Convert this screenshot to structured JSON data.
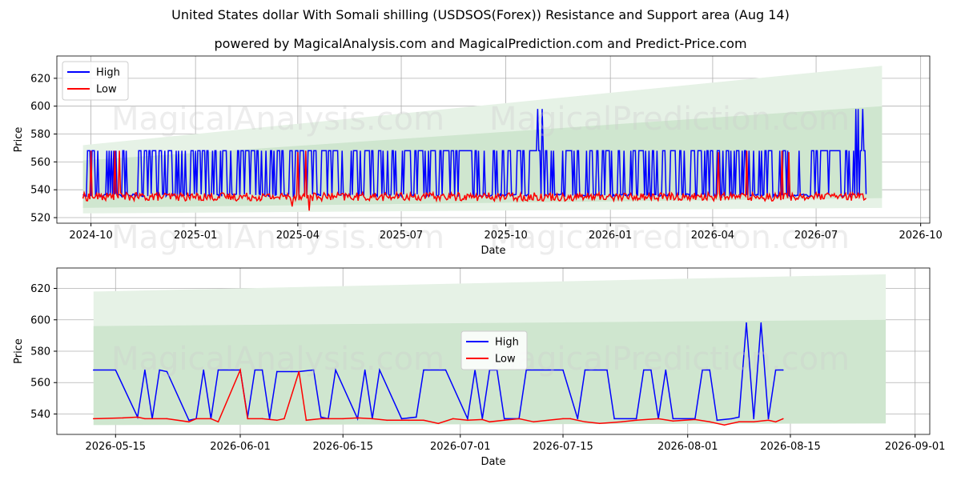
{
  "header": {
    "title": "United States dollar With Somali shilling (USDSOS(Forex)) Resistance and Support area (Aug 14)",
    "subtitle": "powered by MagicalAnalysis.com and MagicalPrediction.com and Predict-Price.com"
  },
  "watermarks": [
    "MagicalAnalysis.com",
    "MagicalPrediction.com"
  ],
  "colors": {
    "high": "#0000ff",
    "low": "#ff0000",
    "band_light": "#e6f2e6",
    "band_dark": "#cfe6cf",
    "grid": "#b0b0b0"
  },
  "chart_data": [
    {
      "type": "line",
      "xlabel": "Date",
      "ylabel": "Price",
      "x_range": [
        "2024-09-01",
        "2026-10-09"
      ],
      "ylim": [
        516,
        636
      ],
      "x_ticks": [
        "2024-10",
        "2025-01",
        "2025-04",
        "2025-07",
        "2025-10",
        "2026-01",
        "2026-04",
        "2026-07",
        "2026-10"
      ],
      "y_ticks": [
        520,
        540,
        560,
        580,
        600,
        620
      ],
      "grid": true,
      "legend": "top-left",
      "legend_entries": [
        "High",
        "Low"
      ],
      "bands": [
        {
          "x": [
            "2024-09-24",
            "2026-08-28"
          ],
          "upper": [
            572,
            629
          ],
          "lower": [
            523,
            527
          ]
        },
        {
          "x": [
            "2024-09-24",
            "2026-08-28"
          ],
          "upper": [
            561,
            600
          ],
          "lower": [
            527,
            534
          ]
        }
      ],
      "series": [
        {
          "name": "High",
          "mode": "osc",
          "start": "2024-09-24",
          "end": "2026-08-14",
          "top": 568,
          "bottom": 536,
          "spikes": [
            [
              "2025-10-29",
              598
            ],
            [
              "2025-11-02",
              598
            ],
            [
              "2026-08-05",
              598
            ],
            [
              "2026-08-07",
              598
            ],
            [
              "2026-08-11",
              598
            ]
          ]
        },
        {
          "name": "Low",
          "mode": "noisy",
          "start": "2024-09-24",
          "end": "2026-08-14",
          "base": 535,
          "spread": 3,
          "spikes": [
            [
              "2024-10-01",
              568
            ],
            [
              "2024-10-22",
              568
            ],
            [
              "2024-10-26",
              568
            ],
            [
              "2025-04-01",
              567
            ],
            [
              "2025-04-08",
              568
            ],
            [
              "2026-04-06",
              567
            ],
            [
              "2026-05-01",
              568
            ],
            [
              "2026-06-01",
              568
            ],
            [
              "2026-06-07",
              567
            ]
          ],
          "dips": [
            [
              "2025-03-27",
              528
            ],
            [
              "2025-04-11",
              525
            ]
          ]
        }
      ]
    },
    {
      "type": "line",
      "xlabel": "Date",
      "ylabel": "Price",
      "x_range": [
        "2026-05-07",
        "2026-09-03"
      ],
      "ylim": [
        527,
        633
      ],
      "x_ticks": [
        "2026-05-15",
        "2026-06-01",
        "2026-06-15",
        "2026-07-01",
        "2026-07-15",
        "2026-08-01",
        "2026-08-15",
        "2026-09-01"
      ],
      "y_ticks": [
        540,
        560,
        580,
        600,
        620
      ],
      "grid": true,
      "legend": "center",
      "legend_entries": [
        "High",
        "Low"
      ],
      "bands": [
        {
          "x": [
            "2026-05-12",
            "2026-08-28"
          ],
          "upper": [
            618,
            629
          ],
          "lower": [
            533,
            534
          ]
        },
        {
          "x": [
            "2026-05-12",
            "2026-08-28"
          ],
          "upper": [
            596,
            600
          ],
          "lower": [
            533,
            534
          ]
        }
      ],
      "series": [
        {
          "name": "High",
          "mode": "points",
          "points": [
            [
              "2026-05-12",
              568
            ],
            [
              "2026-05-15",
              568
            ],
            [
              "2026-05-18",
              538
            ],
            [
              "2026-05-19",
              568
            ],
            [
              "2026-05-20",
              537
            ],
            [
              "2026-05-21",
              568
            ],
            [
              "2026-05-22",
              567
            ],
            [
              "2026-05-25",
              536
            ],
            [
              "2026-05-26",
              537
            ],
            [
              "2026-05-27",
              568
            ],
            [
              "2026-05-28",
              537
            ],
            [
              "2026-05-29",
              568
            ],
            [
              "2026-06-01",
              568
            ],
            [
              "2026-06-02",
              538
            ],
            [
              "2026-06-03",
              568
            ],
            [
              "2026-06-04",
              568
            ],
            [
              "2026-06-05",
              537
            ],
            [
              "2026-06-06",
              567
            ],
            [
              "2026-06-08",
              567
            ],
            [
              "2026-06-09",
              567
            ],
            [
              "2026-06-11",
              568
            ],
            [
              "2026-06-12",
              538
            ],
            [
              "2026-06-13",
              537
            ],
            [
              "2026-06-14",
              568
            ],
            [
              "2026-06-17",
              537
            ],
            [
              "2026-06-18",
              568
            ],
            [
              "2026-06-19",
              537
            ],
            [
              "2026-06-20",
              568
            ],
            [
              "2026-06-23",
              537
            ],
            [
              "2026-06-25",
              538
            ],
            [
              "2026-06-26",
              568
            ],
            [
              "2026-06-29",
              568
            ],
            [
              "2026-07-02",
              537
            ],
            [
              "2026-07-03",
              568
            ],
            [
              "2026-07-04",
              537
            ],
            [
              "2026-07-05",
              568
            ],
            [
              "2026-07-06",
              568
            ],
            [
              "2026-07-07",
              537
            ],
            [
              "2026-07-09",
              537
            ],
            [
              "2026-07-10",
              568
            ],
            [
              "2026-07-15",
              568
            ],
            [
              "2026-07-17",
              537
            ],
            [
              "2026-07-18",
              568
            ],
            [
              "2026-07-21",
              568
            ],
            [
              "2026-07-22",
              537
            ],
            [
              "2026-07-25",
              537
            ],
            [
              "2026-07-26",
              568
            ],
            [
              "2026-07-27",
              568
            ],
            [
              "2026-07-28",
              537
            ],
            [
              "2026-07-29",
              568
            ],
            [
              "2026-07-30",
              537
            ],
            [
              "2026-08-02",
              537
            ],
            [
              "2026-08-03",
              568
            ],
            [
              "2026-08-04",
              568
            ],
            [
              "2026-08-05",
              536
            ],
            [
              "2026-08-07",
              537
            ],
            [
              "2026-08-08",
              538
            ],
            [
              "2026-08-09",
              598
            ],
            [
              "2026-08-10",
              537
            ],
            [
              "2026-08-11",
              598
            ],
            [
              "2026-08-12",
              537
            ],
            [
              "2026-08-13",
              568
            ],
            [
              "2026-08-14",
              568
            ]
          ]
        },
        {
          "name": "Low",
          "mode": "points",
          "points": [
            [
              "2026-05-12",
              537
            ],
            [
              "2026-05-16",
              537.5
            ],
            [
              "2026-05-18",
              538
            ],
            [
              "2026-05-19",
              537
            ],
            [
              "2026-05-22",
              537
            ],
            [
              "2026-05-25",
              535
            ],
            [
              "2026-05-26",
              537
            ],
            [
              "2026-05-28",
              537
            ],
            [
              "2026-05-29",
              535
            ],
            [
              "2026-06-01",
              568
            ],
            [
              "2026-06-02",
              537
            ],
            [
              "2026-06-04",
              537
            ],
            [
              "2026-06-06",
              536
            ],
            [
              "2026-06-07",
              537
            ],
            [
              "2026-06-09",
              567
            ],
            [
              "2026-06-10",
              536
            ],
            [
              "2026-06-12",
              537
            ],
            [
              "2026-06-15",
              537
            ],
            [
              "2026-06-17",
              537.5
            ],
            [
              "2026-06-19",
              537
            ],
            [
              "2026-06-21",
              536
            ],
            [
              "2026-06-24",
              536
            ],
            [
              "2026-06-26",
              536
            ],
            [
              "2026-06-28",
              534
            ],
            [
              "2026-06-30",
              537
            ],
            [
              "2026-07-02",
              536
            ],
            [
              "2026-07-04",
              536.5
            ],
            [
              "2026-07-05",
              535
            ],
            [
              "2026-07-07",
              536
            ],
            [
              "2026-07-09",
              537
            ],
            [
              "2026-07-11",
              535
            ],
            [
              "2026-07-13",
              536
            ],
            [
              "2026-07-15",
              537
            ],
            [
              "2026-07-16",
              537
            ],
            [
              "2026-07-18",
              535
            ],
            [
              "2026-07-20",
              534
            ],
            [
              "2026-07-23",
              535
            ],
            [
              "2026-07-25",
              536
            ],
            [
              "2026-07-28",
              537
            ],
            [
              "2026-07-30",
              535.5
            ],
            [
              "2026-08-02",
              536.5
            ],
            [
              "2026-08-04",
              535
            ],
            [
              "2026-08-06",
              533
            ],
            [
              "2026-08-08",
              535
            ],
            [
              "2026-08-10",
              535
            ],
            [
              "2026-08-12",
              536
            ],
            [
              "2026-08-13",
              535
            ],
            [
              "2026-08-14",
              537
            ]
          ]
        }
      ]
    }
  ]
}
